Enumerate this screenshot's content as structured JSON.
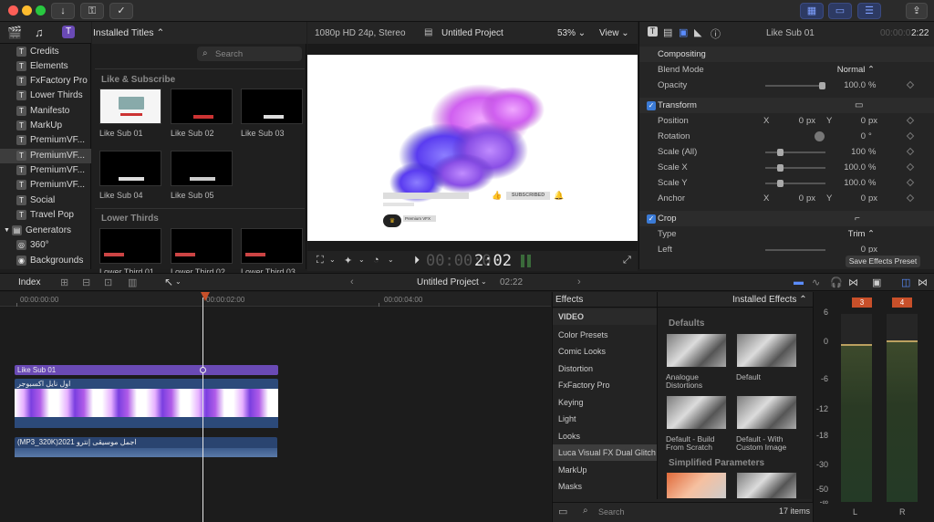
{
  "titlebar": {
    "download_icon": "↓",
    "key_icon": "⚿",
    "check_icon": "✓",
    "share_icon": "⇪"
  },
  "library": {
    "categories": [
      {
        "label": "Credits"
      },
      {
        "label": "Elements"
      },
      {
        "label": "FxFactory Pro"
      },
      {
        "label": "Lower Thirds"
      },
      {
        "label": "Manifesto"
      },
      {
        "label": "MarkUp"
      },
      {
        "label": "PremiumVF..."
      },
      {
        "label": "PremiumVF..."
      },
      {
        "label": "PremiumVF..."
      },
      {
        "label": "PremiumVF..."
      },
      {
        "label": "Social"
      },
      {
        "label": "Travel Pop"
      }
    ],
    "generators": "Generators",
    "gen_items": [
      {
        "label": "360°"
      },
      {
        "label": "Backgrounds"
      }
    ]
  },
  "browser": {
    "title": "Installed Titles ⌃",
    "search_placeholder": "Search",
    "section1": "Like & Subscribe",
    "items1": [
      {
        "label": "Like Sub 01"
      },
      {
        "label": "Like Sub 02"
      },
      {
        "label": "Like Sub 03"
      },
      {
        "label": "Like Sub 04"
      },
      {
        "label": "Like Sub 05"
      }
    ],
    "section2": "Lower Thirds",
    "items2": [
      {
        "label": "Lower Third 01"
      },
      {
        "label": "Lower Third 02"
      },
      {
        "label": "Lower Third 03"
      }
    ]
  },
  "viewer": {
    "format": "1080p HD 24p, Stereo",
    "project": "Untitled Project",
    "zoom": "53% ⌄",
    "view": "View ⌄",
    "subscribed": "SUBSCRIBED",
    "channel": "Premium VFX",
    "timecode_dim": "00:00:0",
    "timecode": "2:02"
  },
  "inspector": {
    "title": "Like Sub 01",
    "time_dim": "00:00:0",
    "time": "2:22",
    "compositing": "Compositing",
    "blend_label": "Blend Mode",
    "blend_value": "Normal ⌃",
    "opacity_label": "Opacity",
    "opacity_value": "100.0",
    "opacity_unit": "%",
    "transform": "Transform",
    "position_label": "Position",
    "pos_x": "0",
    "pos_y": "0",
    "px": "px",
    "rotation_label": "Rotation",
    "rotation_value": "0",
    "deg": "°",
    "scale_all_label": "Scale (All)",
    "scale_all": "100",
    "scale_x_label": "Scale X",
    "scale_x": "100.0",
    "scale_y_label": "Scale Y",
    "scale_y": "100.0",
    "anchor_label": "Anchor",
    "anc_x": "0",
    "anc_y": "0",
    "x_label": "X",
    "y_label": "Y",
    "pct": "%",
    "crop": "Crop",
    "type_label": "Type",
    "type_value": "Trim ⌃",
    "left_label": "Left",
    "left_value": "0",
    "save_preset": "Save Effects Preset"
  },
  "timeline": {
    "index": "Index",
    "project": "Untitled Project",
    "duration": "02:22",
    "r0": "00:00:00:00",
    "r1": "00:00:02:00",
    "r2": "00:00:04:00",
    "title_clip": "Like Sub 01",
    "video_clip": "اول نايل اكسبوجر",
    "audio_clip": "(MP3_320K)2021 اجمل موسيقى إنترو"
  },
  "effects": {
    "header": "Effects",
    "installed": "Installed Effects ⌃",
    "categories": [
      {
        "label": "VIDEO"
      },
      {
        "label": "Color Presets"
      },
      {
        "label": "Comic Looks"
      },
      {
        "label": "Distortion"
      },
      {
        "label": "FxFactory Pro"
      },
      {
        "label": "Keying"
      },
      {
        "label": "Light"
      },
      {
        "label": "Looks"
      },
      {
        "label": "Luca Visual FX Dual Glitch"
      },
      {
        "label": "MarkUp"
      },
      {
        "label": "Masks"
      }
    ],
    "section1": "Defaults",
    "items": [
      {
        "label": "Analogue Distortions"
      },
      {
        "label": "Default"
      },
      {
        "label": "Default - Build From Scratch"
      },
      {
        "label": "Default - With Custom Image"
      }
    ],
    "section2": "Simplified Parameters",
    "search_placeholder": "Search",
    "count": "17 items"
  },
  "meters": {
    "peak_l": "3",
    "peak_r": "4",
    "ticks": [
      "6",
      "0",
      "-6",
      "-12",
      "-18",
      "-30",
      "-50",
      "-∞"
    ],
    "l": "L",
    "r": "R"
  },
  "colors": {
    "accent": "#3b7bd6",
    "title_clip": "#6a4ab5",
    "selection": "#3d3d3d",
    "peak": "#c8502a"
  }
}
